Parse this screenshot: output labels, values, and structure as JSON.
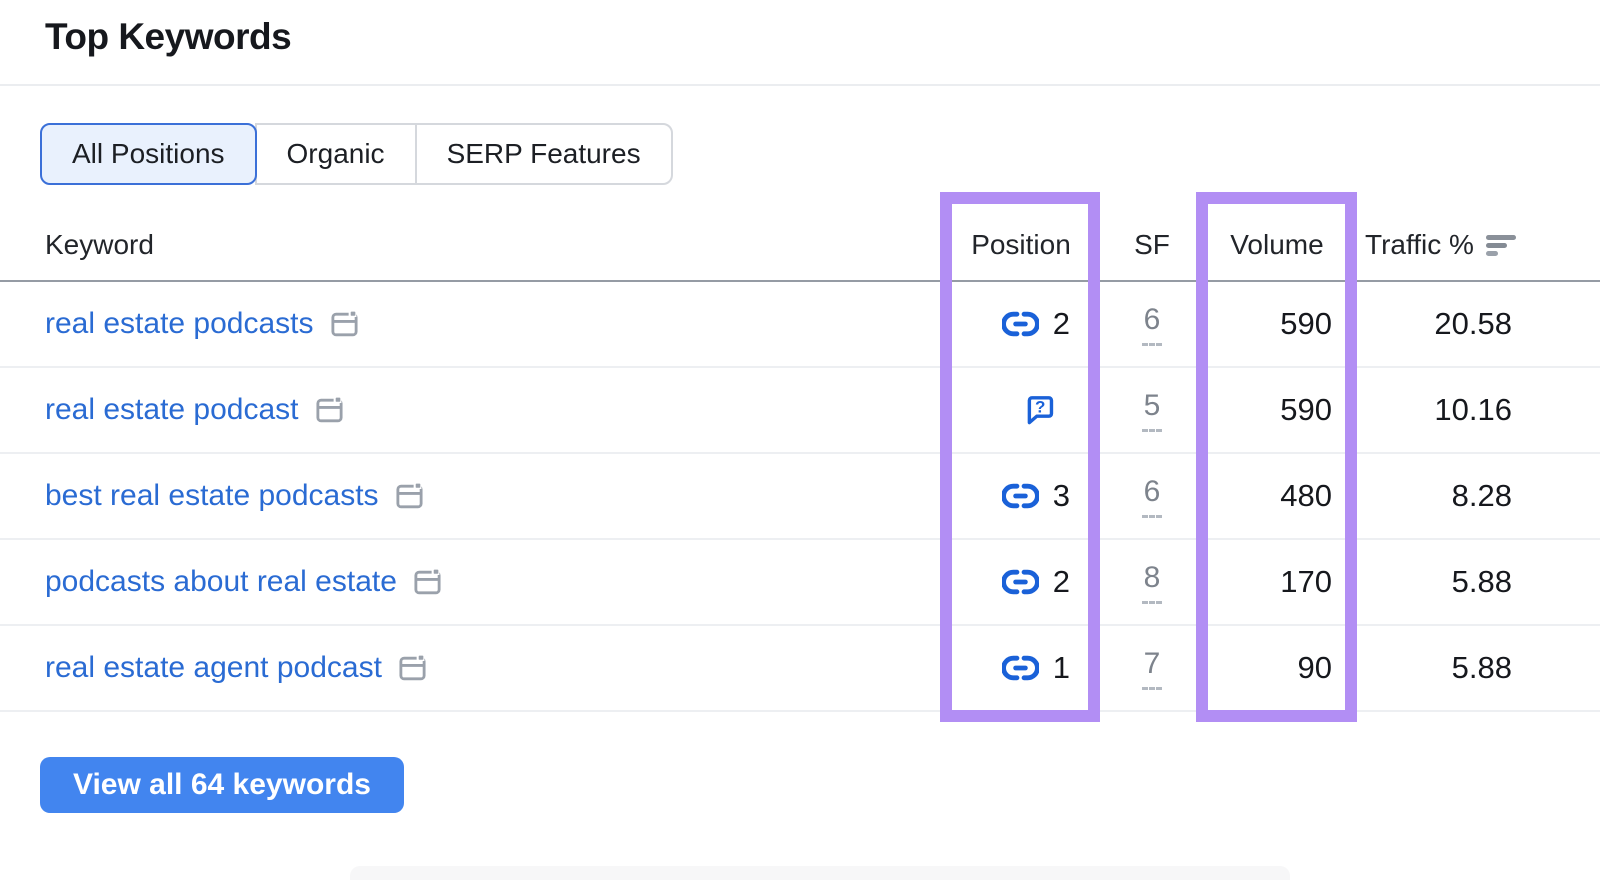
{
  "panel": {
    "title": "Top Keywords"
  },
  "tabs": [
    {
      "label": "All Positions",
      "selected": true
    },
    {
      "label": "Organic",
      "selected": false
    },
    {
      "label": "SERP Features",
      "selected": false
    }
  ],
  "table": {
    "columns": {
      "keyword": "Keyword",
      "position": "Position",
      "sf": "SF",
      "volume": "Volume",
      "traffic": "Traffic %"
    },
    "rows": [
      {
        "keyword": "real estate podcasts",
        "position_icon": "link",
        "position": "2",
        "sf": "6",
        "volume": "590",
        "traffic": "20.58"
      },
      {
        "keyword": "real estate podcast",
        "position_icon": "question-bubble",
        "position": "",
        "sf": "5",
        "volume": "590",
        "traffic": "10.16"
      },
      {
        "keyword": "best real estate podcasts",
        "position_icon": "link",
        "position": "3",
        "sf": "6",
        "volume": "480",
        "traffic": "8.28"
      },
      {
        "keyword": "podcasts about real estate",
        "position_icon": "link",
        "position": "2",
        "sf": "8",
        "volume": "170",
        "traffic": "5.88"
      },
      {
        "keyword": "real estate agent podcast",
        "position_icon": "link",
        "position": "1",
        "sf": "7",
        "volume": "90",
        "traffic": "5.88"
      }
    ]
  },
  "highlights": {
    "color": "#b28ef4",
    "boxes": [
      "position-column",
      "volume-column"
    ]
  },
  "icons": {
    "serp": "serp-preview-icon",
    "link": "link-position-icon",
    "question": "question-bubble-icon",
    "sort": "sort-bars-icon"
  },
  "footer": {
    "view_all_label": "View all 64 keywords"
  },
  "colors": {
    "link_blue": "#2a6bd3",
    "icon_blue": "#1a61d8",
    "button_blue": "#4285ef",
    "highlight_purple": "#b28ef4",
    "header_divider": "#959ba4"
  }
}
